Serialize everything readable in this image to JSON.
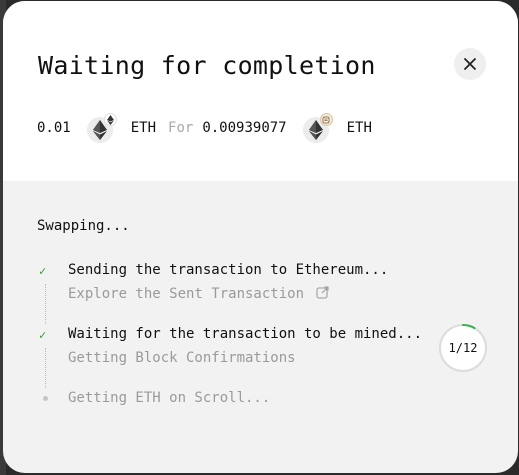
{
  "modal": {
    "title": "Waiting for completion",
    "close_icon": "close-icon"
  },
  "swap": {
    "from_amount": "0.01",
    "from_token": "ETH",
    "from_token_icon": "ethereum-icon",
    "connector": "For",
    "to_amount": "0.00939077",
    "to_token": "ETH",
    "to_token_icon": "ethereum-icon"
  },
  "status": {
    "title": "Swapping..."
  },
  "steps": [
    {
      "label": "Sending the transaction to Ethereum...",
      "sublabel": "Explore the Sent Transaction",
      "state": "done",
      "sublabel_icon": "external-link-icon"
    },
    {
      "label": "Waiting for the transaction to be mined...",
      "sublabel": "Getting Block Confirmations",
      "state": "done",
      "progress_text": "1/12",
      "progress_value": 0.0833
    },
    {
      "label": "Getting ETH on Scroll...",
      "state": "pending"
    }
  ],
  "colors": {
    "check": "#2e9e3e",
    "progress": "#35b24a",
    "muted": "#9a9a9a"
  }
}
